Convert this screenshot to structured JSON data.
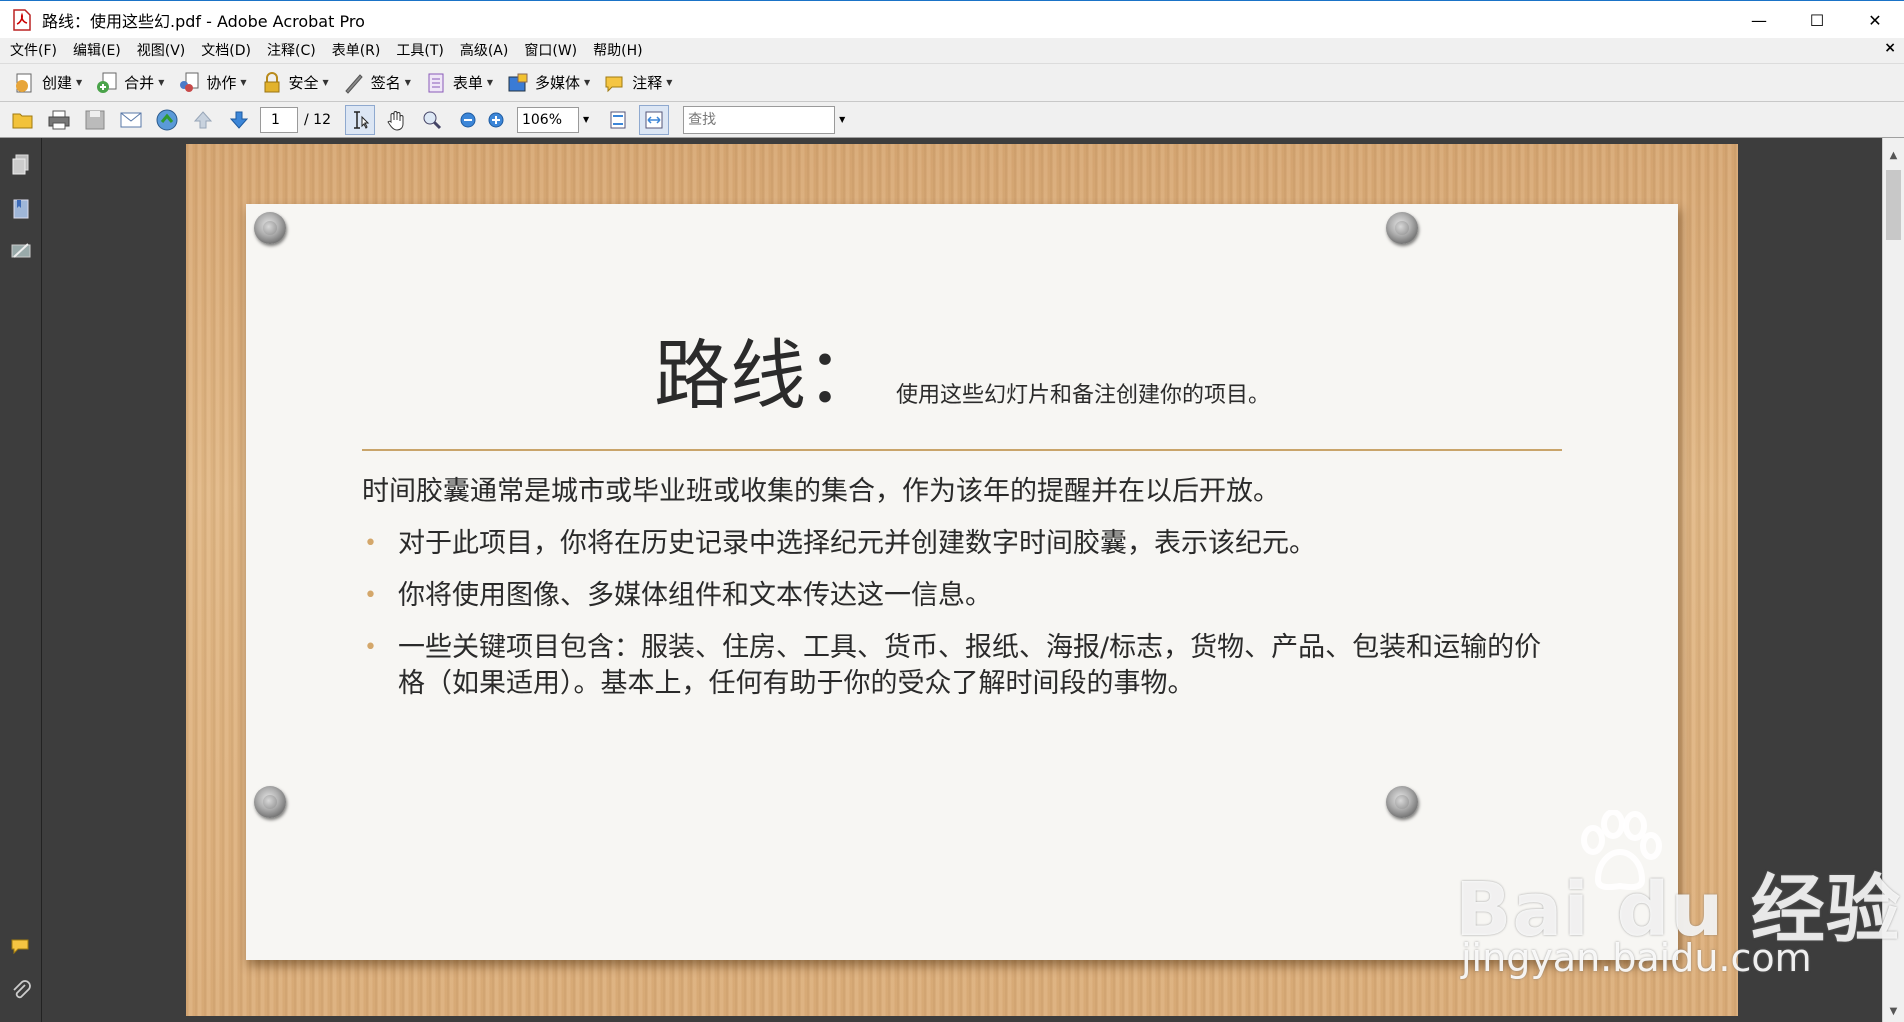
{
  "window": {
    "title": "路线：使用这些幻.pdf - Adobe Acrobat Pro",
    "minimize": "—",
    "maximize": "☐",
    "close": "✕"
  },
  "menu": {
    "items": [
      "文件(F)",
      "编辑(E)",
      "视图(V)",
      "文档(D)",
      "注释(C)",
      "表单(R)",
      "工具(T)",
      "高级(A)",
      "窗口(W)",
      "帮助(H)"
    ],
    "close_doc": "×"
  },
  "toolbar": {
    "create": "创建",
    "combine": "合并",
    "collaborate": "协作",
    "secure": "安全",
    "sign": "签名",
    "forms": "表单",
    "multimedia": "多媒体",
    "comment": "注释"
  },
  "navigation": {
    "current_page": "1",
    "total_pages": "/ 12",
    "zoom": "106%",
    "find_placeholder": "查找"
  },
  "slide": {
    "title_big": "路线：",
    "title_small": "使用这些幻灯片和备注创建你的项目。",
    "intro": "时间胶囊通常是城市或毕业班或收集的集合，作为该年的提醒并在以后开放。",
    "bullets": [
      "对于此项目，你将在历史记录中选择纪元并创建数字时间胶囊，表示该纪元。",
      "你将使用图像、多媒体组件和文本传达这一信息。",
      "一些关键项目包含：服装、住房、工具、货币、报纸、海报/标志，货物、产品、包装和运输的价格（如果适用）。基本上，任何有助于你的受众了解时间段的事物。"
    ],
    "bullet_glyph": "•"
  },
  "watermark": {
    "brand": "Bai du 经验",
    "url": "jingyan.baidu.com"
  },
  "colors": {
    "accent_rule": "#c9a46a",
    "bullet": "#d4a76a",
    "nav_bg": "#3d3d3d"
  }
}
